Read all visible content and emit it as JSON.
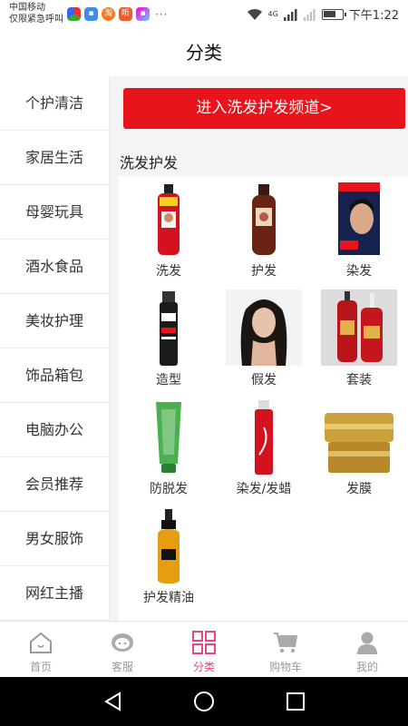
{
  "status_bar": {
    "carrier_line1": "中国移动",
    "carrier_line2": "仅限紧急呼叫",
    "time": "下午1:22",
    "network": "4G"
  },
  "header": {
    "title": "分类"
  },
  "sidebar": {
    "items": [
      {
        "label": "个护清洁"
      },
      {
        "label": "家居生活"
      },
      {
        "label": "母婴玩具"
      },
      {
        "label": "酒水食品"
      },
      {
        "label": "美妆护理"
      },
      {
        "label": "饰品箱包"
      },
      {
        "label": "电脑办公"
      },
      {
        "label": "会员推荐"
      },
      {
        "label": "男女服饰"
      },
      {
        "label": "网红主播"
      }
    ]
  },
  "main": {
    "banner_label": "进入洗发护发频道>",
    "section_title": "洗发护发",
    "products": [
      {
        "label": "洗发",
        "icon": "red-shampoo-bottle-icon"
      },
      {
        "label": "护发",
        "icon": "brown-conditioner-bottle-icon"
      },
      {
        "label": "染发",
        "icon": "hair-dye-box-icon"
      },
      {
        "label": "造型",
        "icon": "styling-spray-can-icon"
      },
      {
        "label": "假发",
        "icon": "wig-model-icon"
      },
      {
        "label": "套装",
        "icon": "product-set-icon"
      },
      {
        "label": "防脱发",
        "icon": "green-tube-icon"
      },
      {
        "label": "染发/发蜡",
        "icon": "red-spray-can-icon"
      },
      {
        "label": "发膜",
        "icon": "gold-jar-icon"
      },
      {
        "label": "护发精油",
        "icon": "hair-oil-bottle-icon"
      }
    ]
  },
  "bottom_nav": {
    "items": [
      {
        "label": "首页",
        "icon": "home-icon"
      },
      {
        "label": "客服",
        "icon": "customer-service-icon"
      },
      {
        "label": "分类",
        "icon": "category-grid-icon"
      },
      {
        "label": "购物车",
        "icon": "cart-icon"
      },
      {
        "label": "我的",
        "icon": "profile-icon"
      }
    ],
    "active_index": 2
  },
  "colors": {
    "accent_red": "#e8141b",
    "active_pink": "#e8467c",
    "inactive_gray": "#999999"
  }
}
